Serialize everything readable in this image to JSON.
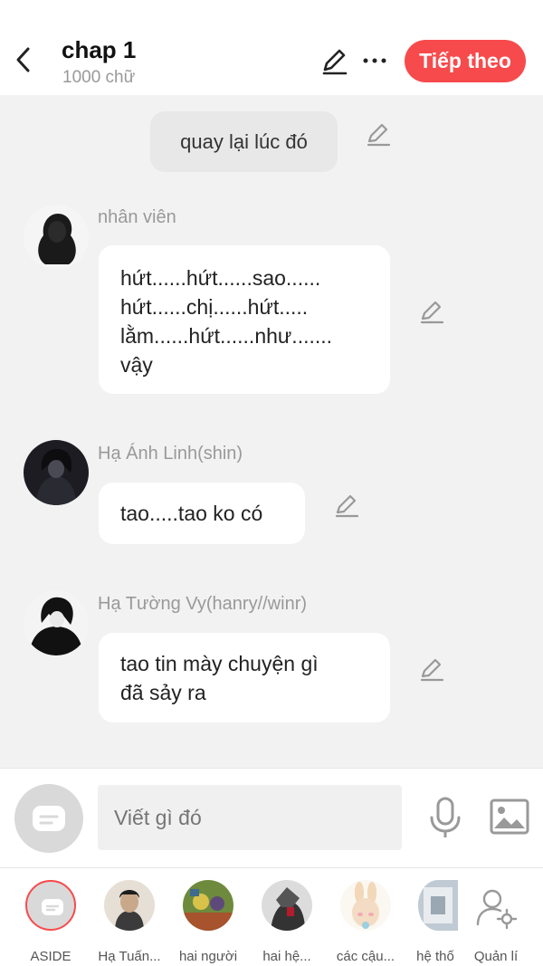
{
  "header": {
    "title": "chap 1",
    "subtitle": "1000 chữ",
    "next_label": "Tiếp theo",
    "accent_color": "#f74a4c"
  },
  "messages": {
    "narration": "quay lại lúc đó",
    "m1": {
      "name": "nhân viên",
      "text": "hứt......hứt......sao......\nhứt......chị......hứt.....\nlằm......hứt......như.......\nvậy"
    },
    "m2": {
      "name": "Hạ Ánh Linh(shin)",
      "text": "tao.....tao ko có"
    },
    "m3": {
      "name": "Hạ Tường Vy(hanry//winr)",
      "text": "tao tin mày chuyện gì\nđã sảy ra"
    }
  },
  "composer": {
    "placeholder": "Viết gì đó"
  },
  "characters": [
    {
      "label": "ASIDE"
    },
    {
      "label": "Hạ Tuấn..."
    },
    {
      "label": "hai người"
    },
    {
      "label": "hai hệ..."
    },
    {
      "label": "các cậu..."
    },
    {
      "label": "hệ thố"
    },
    {
      "label": "Quản lí"
    }
  ]
}
